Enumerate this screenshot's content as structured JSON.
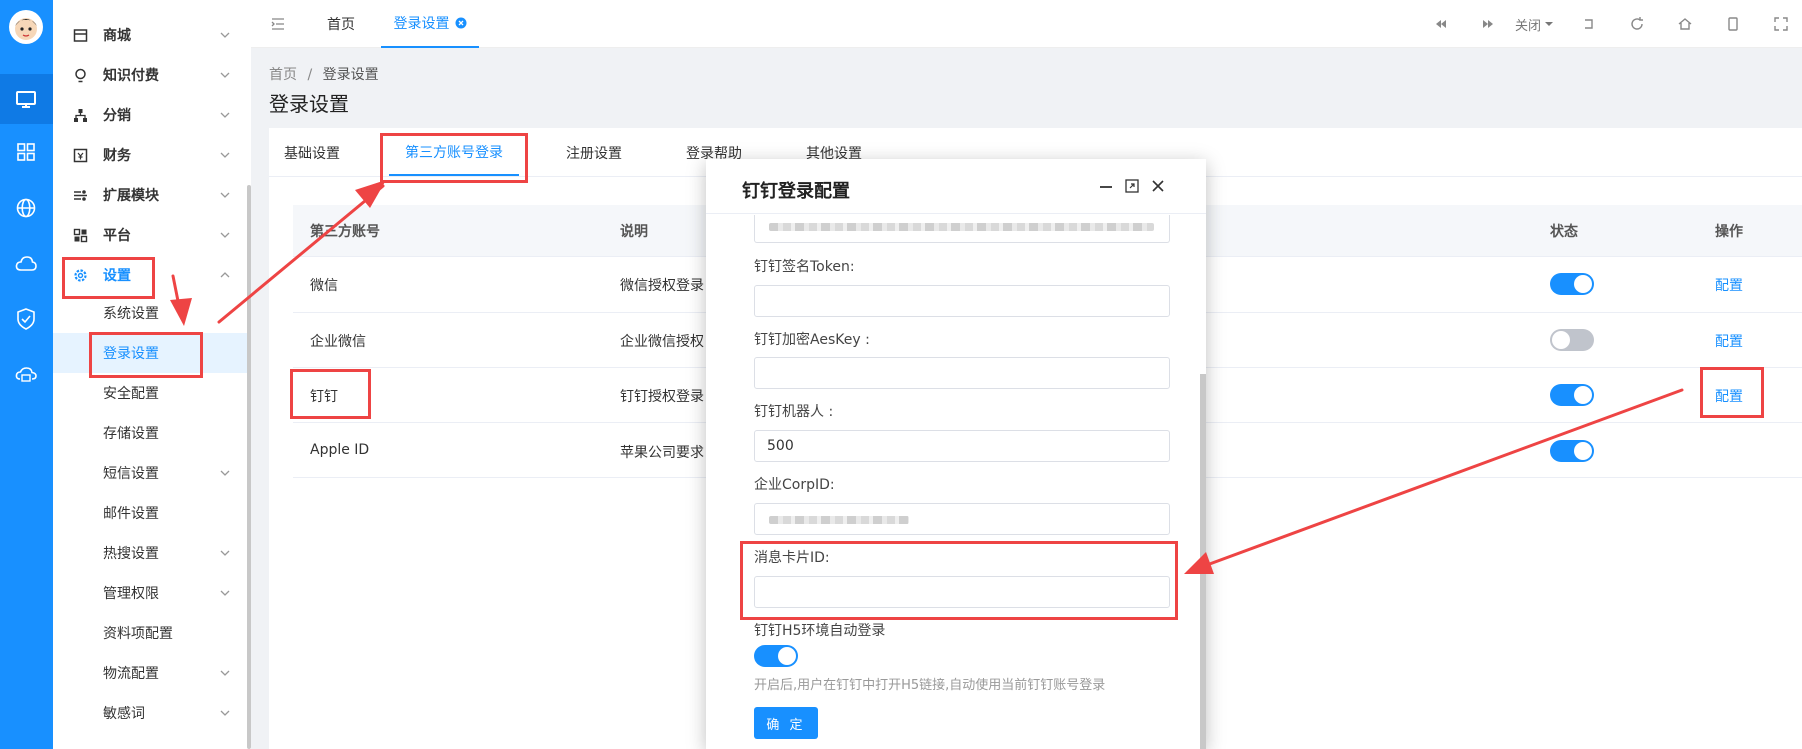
{
  "sidebar": {
    "menu": [
      {
        "label": "商城",
        "icon": "shop-icon"
      },
      {
        "label": "知识付费",
        "icon": "bulb-icon"
      },
      {
        "label": "分销",
        "icon": "tree-icon"
      },
      {
        "label": "财务",
        "icon": "finance-icon"
      },
      {
        "label": "扩展模块",
        "icon": "extend-icon"
      },
      {
        "label": "平台",
        "icon": "platform-icon"
      },
      {
        "label": "设置",
        "icon": "gear-icon"
      }
    ],
    "submenu": [
      "系统设置",
      "登录设置",
      "安全配置",
      "存储设置",
      "短信设置",
      "邮件设置",
      "热搜设置",
      "管理权限",
      "资料项配置",
      "物流配置",
      "敏感词"
    ]
  },
  "topbar": {
    "tabs": [
      {
        "label": "首页"
      },
      {
        "label": "登录设置"
      }
    ],
    "close_label": "关闭"
  },
  "breadcrumb": {
    "home": "首页",
    "sep": "/",
    "current": "登录设置"
  },
  "page_title": "登录设置",
  "settings_tabs": [
    "基础设置",
    "第三方账号登录",
    "注册设置",
    "登录帮助",
    "其他设置"
  ],
  "table": {
    "headers": {
      "account": "第三方账号",
      "desc": "说明",
      "status": "状态",
      "action": "操作"
    },
    "rows": [
      {
        "name": "微信",
        "desc": "微信授权登录",
        "on": true,
        "action": "配置"
      },
      {
        "name": "企业微信",
        "desc": "企业微信授权",
        "on": false,
        "action": "配置"
      },
      {
        "name": "钉钉",
        "desc": "钉钉授权登录",
        "on": true,
        "action": "配置"
      },
      {
        "name": "Apple ID",
        "desc": "苹果公司要求",
        "on": true,
        "action": ""
      }
    ]
  },
  "modal": {
    "title": "钉钉登录配置",
    "fields": [
      {
        "label": "钉钉签名Token:",
        "value": ""
      },
      {
        "label": "钉钉加密AesKey :",
        "value": ""
      },
      {
        "label": "钉钉机器人 :",
        "value": "500"
      },
      {
        "label": "企业CorpID:",
        "value": ""
      },
      {
        "label": "消息卡片ID:",
        "value": ""
      }
    ],
    "switch_label": "钉钉H5环境自动登录",
    "switch_on": true,
    "hint": "开启后,用户在钉钉中打开H5链接,自动使用当前钉钉账号登录",
    "ok_label": "确 定"
  },
  "colors": {
    "primary": "#1890ff",
    "annotation": "#ee4444"
  }
}
